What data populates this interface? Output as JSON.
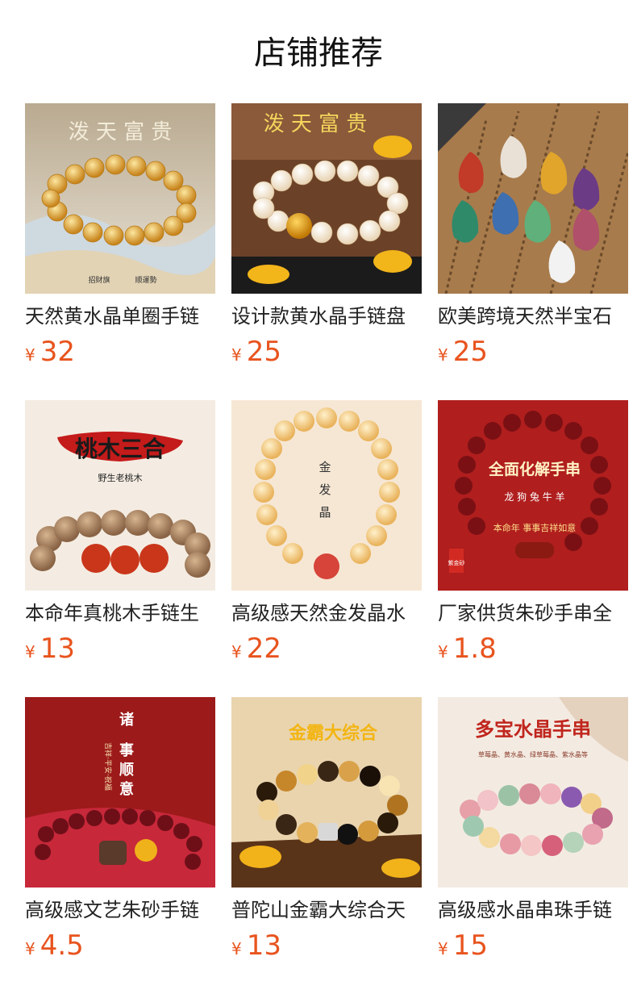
{
  "section": {
    "title": "店铺推荐"
  },
  "currency_symbol": "¥",
  "products": [
    {
      "name": "天然黄水晶单圈手链",
      "price": "32",
      "thumb_text": [
        "泼 天 富 贵",
        "招财旗",
        "顺運勢"
      ]
    },
    {
      "name": "设计款黄水晶手链盘",
      "price": "25",
      "thumb_text": [
        "泼 天 富 贵"
      ]
    },
    {
      "name": "欧美跨境天然半宝石",
      "price": "25",
      "thumb_text": []
    },
    {
      "name": "本命年真桃木手链生",
      "price": "13",
      "thumb_text": [
        "桃木三合",
        "野生老桃木"
      ]
    },
    {
      "name": "高级感天然金发晶水",
      "price": "22",
      "thumb_text": [
        "金",
        "发",
        "晶"
      ]
    },
    {
      "name": "厂家供货朱砂手串全",
      "price": "1.8",
      "thumb_text": [
        "全面化解手串",
        "龙 狗 兔 牛 羊",
        "本命年 事事吉祥如意",
        "紫金砂"
      ]
    },
    {
      "name": "高级感文艺朱砂手链",
      "price": "4.5",
      "thumb_text": [
        "诸",
        "事",
        "顺",
        "意",
        "吉祥·平安·祝福"
      ]
    },
    {
      "name": "普陀山金霸大综合天",
      "price": "13",
      "thumb_text": [
        "金霸大综合"
      ]
    },
    {
      "name": "高级感水晶串珠手链",
      "price": "15",
      "thumb_text": [
        "多宝水晶手串",
        "草莓晶、黄水晶、绿草莓晶、紫水晶等"
      ]
    }
  ]
}
